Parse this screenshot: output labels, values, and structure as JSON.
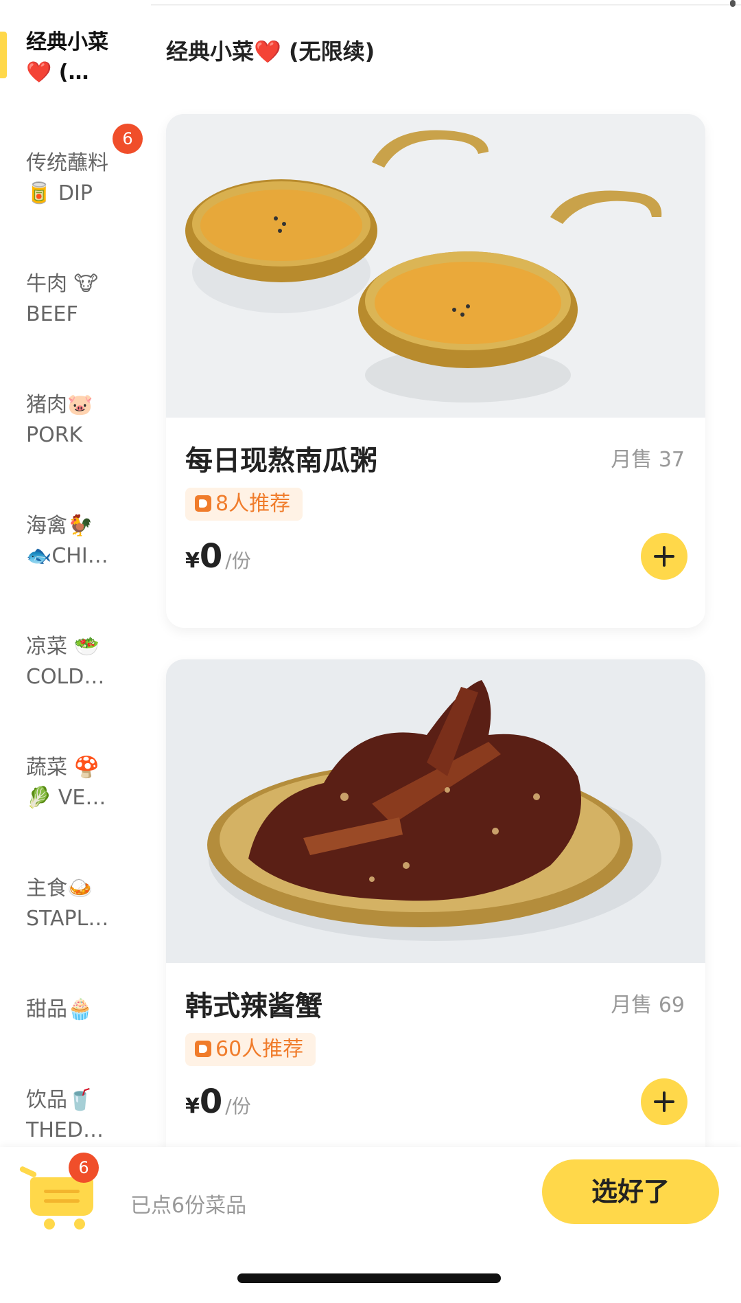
{
  "sidebar": {
    "categories": [
      {
        "line1": "经典小菜",
        "line2": "❤️ (…",
        "active": true
      },
      {
        "line1": "传统蘸料",
        "line2": "🥫 DIP",
        "badge": "6"
      },
      {
        "line1": "牛肉 🐮",
        "line2": "BEEF"
      },
      {
        "line1": "猪肉🐷",
        "line2": "PORK"
      },
      {
        "line1": "海禽🐓",
        "line2": "🐟CHI…"
      },
      {
        "line1": "凉菜 🥗",
        "line2": "COLD…"
      },
      {
        "line1": "蔬菜 🍄",
        "line2": "🥬 VE…"
      },
      {
        "line1": "主食🍛",
        "line2": "STAPL…"
      },
      {
        "line1": "甜品🧁",
        "line2": ""
      },
      {
        "line1": "饮品🥤",
        "line2": "THED…"
      }
    ]
  },
  "section": {
    "title": "经典小菜❤️ (无限续)"
  },
  "dishes": [
    {
      "name": "每日现熬南瓜粥",
      "sales": "月售 37",
      "recommend": "8人推荐",
      "currency": "¥",
      "price": "0",
      "unit": "/份"
    },
    {
      "name": "韩式辣酱蟹",
      "sales": "月售 69",
      "recommend": "60人推荐",
      "currency": "¥",
      "price": "0",
      "unit": "/份"
    }
  ],
  "cart": {
    "count": "6",
    "summary": "已点6份菜品",
    "checkout_label": "选好了"
  },
  "colors": {
    "accent": "#ffd84a",
    "badge": "#f04e2a",
    "recommend": "#f07c2b"
  }
}
